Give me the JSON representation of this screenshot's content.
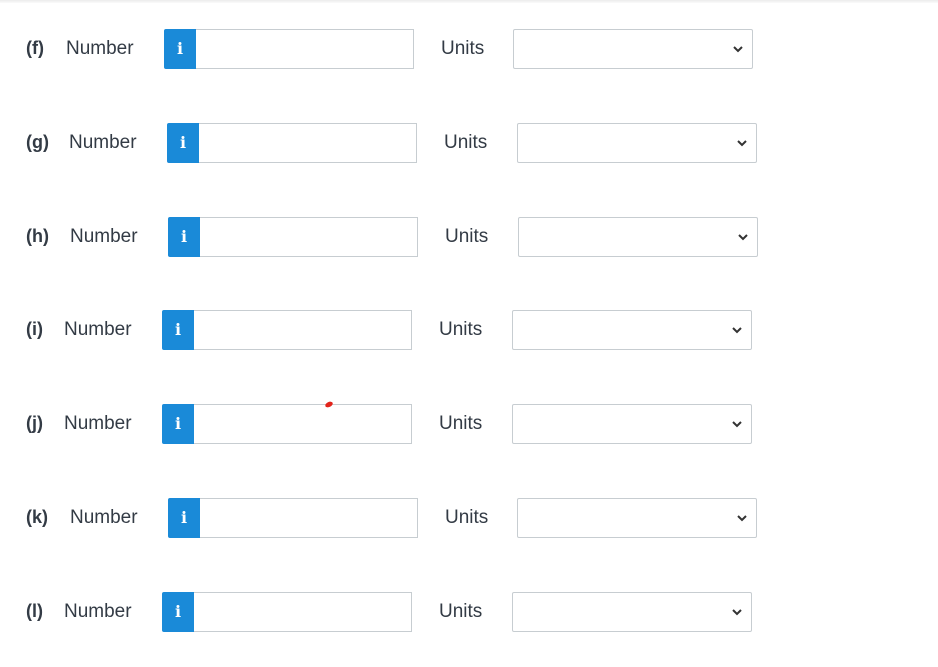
{
  "rows": [
    {
      "part": "(f)",
      "number_label": "Number",
      "number_value": "",
      "info_icon": "info-icon",
      "units_label": "Units",
      "units_selected": ""
    },
    {
      "part": "(g)",
      "number_label": "Number",
      "number_value": "",
      "info_icon": "info-icon",
      "units_label": "Units",
      "units_selected": ""
    },
    {
      "part": "(h)",
      "number_label": "Number",
      "number_value": "",
      "info_icon": "info-icon",
      "units_label": "Units",
      "units_selected": ""
    },
    {
      "part": "(i)",
      "number_label": "Number",
      "number_value": "",
      "info_icon": "info-icon",
      "units_label": "Units",
      "units_selected": ""
    },
    {
      "part": "(j)",
      "number_label": "Number",
      "number_value": "",
      "info_icon": "info-icon",
      "units_label": "Units",
      "units_selected": ""
    },
    {
      "part": "(k)",
      "number_label": "Number",
      "number_value": "",
      "info_icon": "info-icon",
      "units_label": "Units",
      "units_selected": ""
    },
    {
      "part": "(l)",
      "number_label": "Number",
      "number_value": "",
      "info_icon": "info-icon",
      "units_label": "Units",
      "units_selected": ""
    }
  ],
  "info_glyph": "i",
  "colors": {
    "info_button": "#1a8ad8",
    "input_border": "#c7cdd1",
    "label_text": "#333b45",
    "stray_mark": "#e2241b"
  }
}
